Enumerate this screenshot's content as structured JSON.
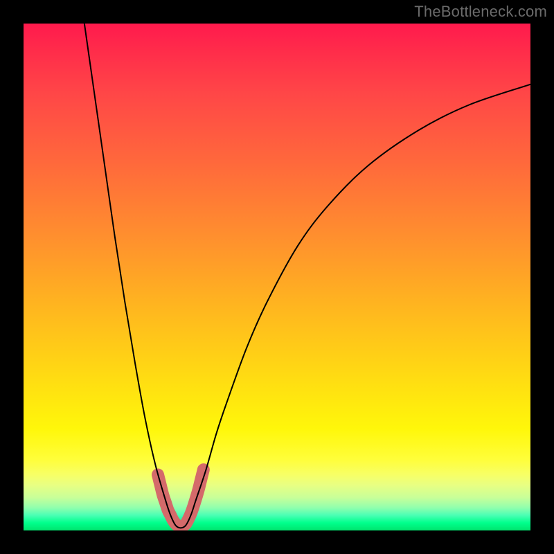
{
  "watermark": "TheBottleneck.com",
  "chart_data": {
    "type": "line",
    "title": "",
    "xlabel": "",
    "ylabel": "",
    "xlim": [
      0,
      100
    ],
    "ylim": [
      0,
      100
    ],
    "series": [
      {
        "name": "bottleneck-curve",
        "x": [
          12,
          14,
          16,
          18,
          20,
          22,
          24,
          26,
          28,
          29,
          30,
          31,
          32,
          33,
          34,
          36,
          38,
          40,
          44,
          48,
          54,
          60,
          68,
          78,
          88,
          100
        ],
        "values": [
          100,
          86,
          72,
          58,
          45,
          33,
          22,
          13,
          6,
          3,
          1,
          0.5,
          1,
          3,
          6,
          12,
          19,
          25,
          36,
          45,
          56,
          64,
          72,
          79,
          84,
          88
        ],
        "stroke": "#000000",
        "stroke_width": 2
      },
      {
        "name": "highlight-valley",
        "x": [
          26.5,
          27,
          27.5,
          28,
          28.5,
          29,
          29.5,
          30,
          30.5,
          31,
          31.5,
          32,
          32.5,
          33,
          33.5,
          34,
          34.5,
          35,
          35.5
        ],
        "values": [
          11,
          9,
          7,
          5.5,
          4,
          3,
          2,
          1.3,
          0.9,
          0.7,
          0.9,
          1.3,
          2.2,
          3.3,
          4.7,
          6.3,
          8,
          10,
          12
        ],
        "stroke": "#d46a6a",
        "stroke_width": 18
      }
    ],
    "background_gradient": {
      "stops": [
        {
          "pos": 0.0,
          "color": "#ff1a4d"
        },
        {
          "pos": 0.5,
          "color": "#ffb61f"
        },
        {
          "pos": 0.8,
          "color": "#fff70a"
        },
        {
          "pos": 0.95,
          "color": "#91ffad"
        },
        {
          "pos": 1.0,
          "color": "#00e46e"
        }
      ]
    }
  }
}
